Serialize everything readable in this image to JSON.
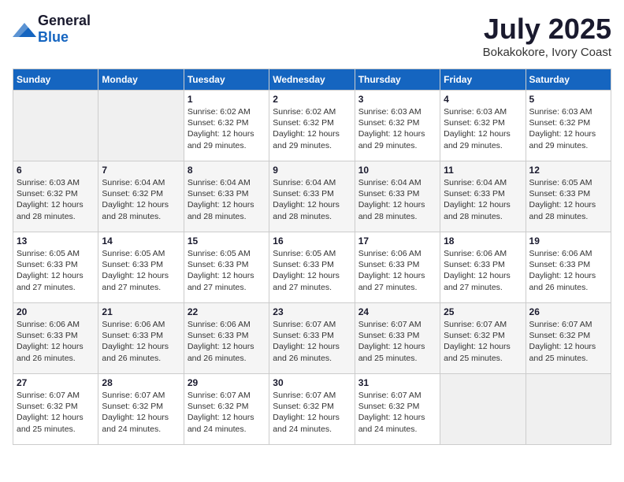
{
  "header": {
    "logo_general": "General",
    "logo_blue": "Blue",
    "month_year": "July 2025",
    "location": "Bokakokore, Ivory Coast"
  },
  "days_of_week": [
    "Sunday",
    "Monday",
    "Tuesday",
    "Wednesday",
    "Thursday",
    "Friday",
    "Saturday"
  ],
  "weeks": [
    [
      {
        "day": "",
        "sunrise": "",
        "sunset": "",
        "daylight": "",
        "empty": true
      },
      {
        "day": "",
        "sunrise": "",
        "sunset": "",
        "daylight": "",
        "empty": true
      },
      {
        "day": "1",
        "sunrise": "Sunrise: 6:02 AM",
        "sunset": "Sunset: 6:32 PM",
        "daylight": "Daylight: 12 hours and 29 minutes."
      },
      {
        "day": "2",
        "sunrise": "Sunrise: 6:02 AM",
        "sunset": "Sunset: 6:32 PM",
        "daylight": "Daylight: 12 hours and 29 minutes."
      },
      {
        "day": "3",
        "sunrise": "Sunrise: 6:03 AM",
        "sunset": "Sunset: 6:32 PM",
        "daylight": "Daylight: 12 hours and 29 minutes."
      },
      {
        "day": "4",
        "sunrise": "Sunrise: 6:03 AM",
        "sunset": "Sunset: 6:32 PM",
        "daylight": "Daylight: 12 hours and 29 minutes."
      },
      {
        "day": "5",
        "sunrise": "Sunrise: 6:03 AM",
        "sunset": "Sunset: 6:32 PM",
        "daylight": "Daylight: 12 hours and 29 minutes."
      }
    ],
    [
      {
        "day": "6",
        "sunrise": "Sunrise: 6:03 AM",
        "sunset": "Sunset: 6:32 PM",
        "daylight": "Daylight: 12 hours and 28 minutes."
      },
      {
        "day": "7",
        "sunrise": "Sunrise: 6:04 AM",
        "sunset": "Sunset: 6:32 PM",
        "daylight": "Daylight: 12 hours and 28 minutes."
      },
      {
        "day": "8",
        "sunrise": "Sunrise: 6:04 AM",
        "sunset": "Sunset: 6:33 PM",
        "daylight": "Daylight: 12 hours and 28 minutes."
      },
      {
        "day": "9",
        "sunrise": "Sunrise: 6:04 AM",
        "sunset": "Sunset: 6:33 PM",
        "daylight": "Daylight: 12 hours and 28 minutes."
      },
      {
        "day": "10",
        "sunrise": "Sunrise: 6:04 AM",
        "sunset": "Sunset: 6:33 PM",
        "daylight": "Daylight: 12 hours and 28 minutes."
      },
      {
        "day": "11",
        "sunrise": "Sunrise: 6:04 AM",
        "sunset": "Sunset: 6:33 PM",
        "daylight": "Daylight: 12 hours and 28 minutes."
      },
      {
        "day": "12",
        "sunrise": "Sunrise: 6:05 AM",
        "sunset": "Sunset: 6:33 PM",
        "daylight": "Daylight: 12 hours and 28 minutes."
      }
    ],
    [
      {
        "day": "13",
        "sunrise": "Sunrise: 6:05 AM",
        "sunset": "Sunset: 6:33 PM",
        "daylight": "Daylight: 12 hours and 27 minutes."
      },
      {
        "day": "14",
        "sunrise": "Sunrise: 6:05 AM",
        "sunset": "Sunset: 6:33 PM",
        "daylight": "Daylight: 12 hours and 27 minutes."
      },
      {
        "day": "15",
        "sunrise": "Sunrise: 6:05 AM",
        "sunset": "Sunset: 6:33 PM",
        "daylight": "Daylight: 12 hours and 27 minutes."
      },
      {
        "day": "16",
        "sunrise": "Sunrise: 6:05 AM",
        "sunset": "Sunset: 6:33 PM",
        "daylight": "Daylight: 12 hours and 27 minutes."
      },
      {
        "day": "17",
        "sunrise": "Sunrise: 6:06 AM",
        "sunset": "Sunset: 6:33 PM",
        "daylight": "Daylight: 12 hours and 27 minutes."
      },
      {
        "day": "18",
        "sunrise": "Sunrise: 6:06 AM",
        "sunset": "Sunset: 6:33 PM",
        "daylight": "Daylight: 12 hours and 27 minutes."
      },
      {
        "day": "19",
        "sunrise": "Sunrise: 6:06 AM",
        "sunset": "Sunset: 6:33 PM",
        "daylight": "Daylight: 12 hours and 26 minutes."
      }
    ],
    [
      {
        "day": "20",
        "sunrise": "Sunrise: 6:06 AM",
        "sunset": "Sunset: 6:33 PM",
        "daylight": "Daylight: 12 hours and 26 minutes."
      },
      {
        "day": "21",
        "sunrise": "Sunrise: 6:06 AM",
        "sunset": "Sunset: 6:33 PM",
        "daylight": "Daylight: 12 hours and 26 minutes."
      },
      {
        "day": "22",
        "sunrise": "Sunrise: 6:06 AM",
        "sunset": "Sunset: 6:33 PM",
        "daylight": "Daylight: 12 hours and 26 minutes."
      },
      {
        "day": "23",
        "sunrise": "Sunrise: 6:07 AM",
        "sunset": "Sunset: 6:33 PM",
        "daylight": "Daylight: 12 hours and 26 minutes."
      },
      {
        "day": "24",
        "sunrise": "Sunrise: 6:07 AM",
        "sunset": "Sunset: 6:33 PM",
        "daylight": "Daylight: 12 hours and 25 minutes."
      },
      {
        "day": "25",
        "sunrise": "Sunrise: 6:07 AM",
        "sunset": "Sunset: 6:32 PM",
        "daylight": "Daylight: 12 hours and 25 minutes."
      },
      {
        "day": "26",
        "sunrise": "Sunrise: 6:07 AM",
        "sunset": "Sunset: 6:32 PM",
        "daylight": "Daylight: 12 hours and 25 minutes."
      }
    ],
    [
      {
        "day": "27",
        "sunrise": "Sunrise: 6:07 AM",
        "sunset": "Sunset: 6:32 PM",
        "daylight": "Daylight: 12 hours and 25 minutes."
      },
      {
        "day": "28",
        "sunrise": "Sunrise: 6:07 AM",
        "sunset": "Sunset: 6:32 PM",
        "daylight": "Daylight: 12 hours and 24 minutes."
      },
      {
        "day": "29",
        "sunrise": "Sunrise: 6:07 AM",
        "sunset": "Sunset: 6:32 PM",
        "daylight": "Daylight: 12 hours and 24 minutes."
      },
      {
        "day": "30",
        "sunrise": "Sunrise: 6:07 AM",
        "sunset": "Sunset: 6:32 PM",
        "daylight": "Daylight: 12 hours and 24 minutes."
      },
      {
        "day": "31",
        "sunrise": "Sunrise: 6:07 AM",
        "sunset": "Sunset: 6:32 PM",
        "daylight": "Daylight: 12 hours and 24 minutes."
      },
      {
        "day": "",
        "sunrise": "",
        "sunset": "",
        "daylight": "",
        "empty": true
      },
      {
        "day": "",
        "sunrise": "",
        "sunset": "",
        "daylight": "",
        "empty": true
      }
    ]
  ]
}
